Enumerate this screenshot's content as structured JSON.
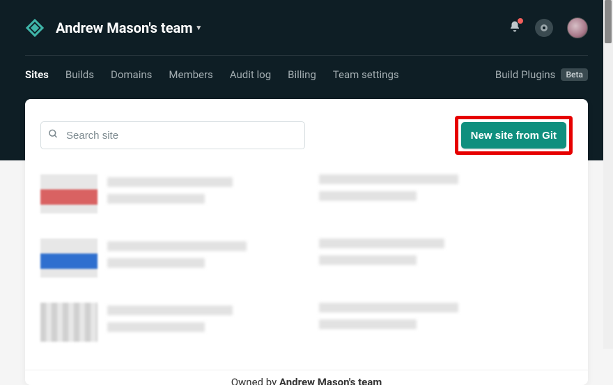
{
  "header": {
    "team_name": "Andrew Mason's team"
  },
  "tabs": {
    "items": [
      "Sites",
      "Builds",
      "Domains",
      "Members",
      "Audit log",
      "Billing",
      "Team settings"
    ],
    "active_index": 0,
    "build_plugins_label": "Build Plugins",
    "beta_label": "Beta"
  },
  "search": {
    "placeholder": "Search site"
  },
  "actions": {
    "new_site_label": "New site from Git"
  },
  "footer": {
    "owned_prefix": "Owned by ",
    "owned_team": "Andrew Mason's team"
  }
}
